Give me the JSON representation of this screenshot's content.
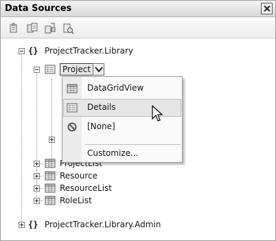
{
  "window": {
    "title": "Data Sources"
  },
  "tree": {
    "root": "ProjectTracker.Library",
    "selected_node": "Project",
    "nodes": [
      "ProjectList",
      "Resource",
      "ResourceList",
      "RoleList"
    ],
    "second_root": "ProjectTracker.Library.Admin"
  },
  "dropdown_menu": {
    "items": [
      {
        "label": "DataGridView",
        "icon": "datagrid-icon"
      },
      {
        "label": "Details",
        "icon": "details-icon"
      },
      {
        "label": "[None]",
        "icon": "none-icon"
      },
      {
        "label": "Customize..."
      }
    ],
    "hovered": "Details"
  },
  "colors": {
    "title_bg": "#d8d8d8",
    "menu_bg": "#fafafa",
    "hover_bg": "#e6e6e6"
  }
}
